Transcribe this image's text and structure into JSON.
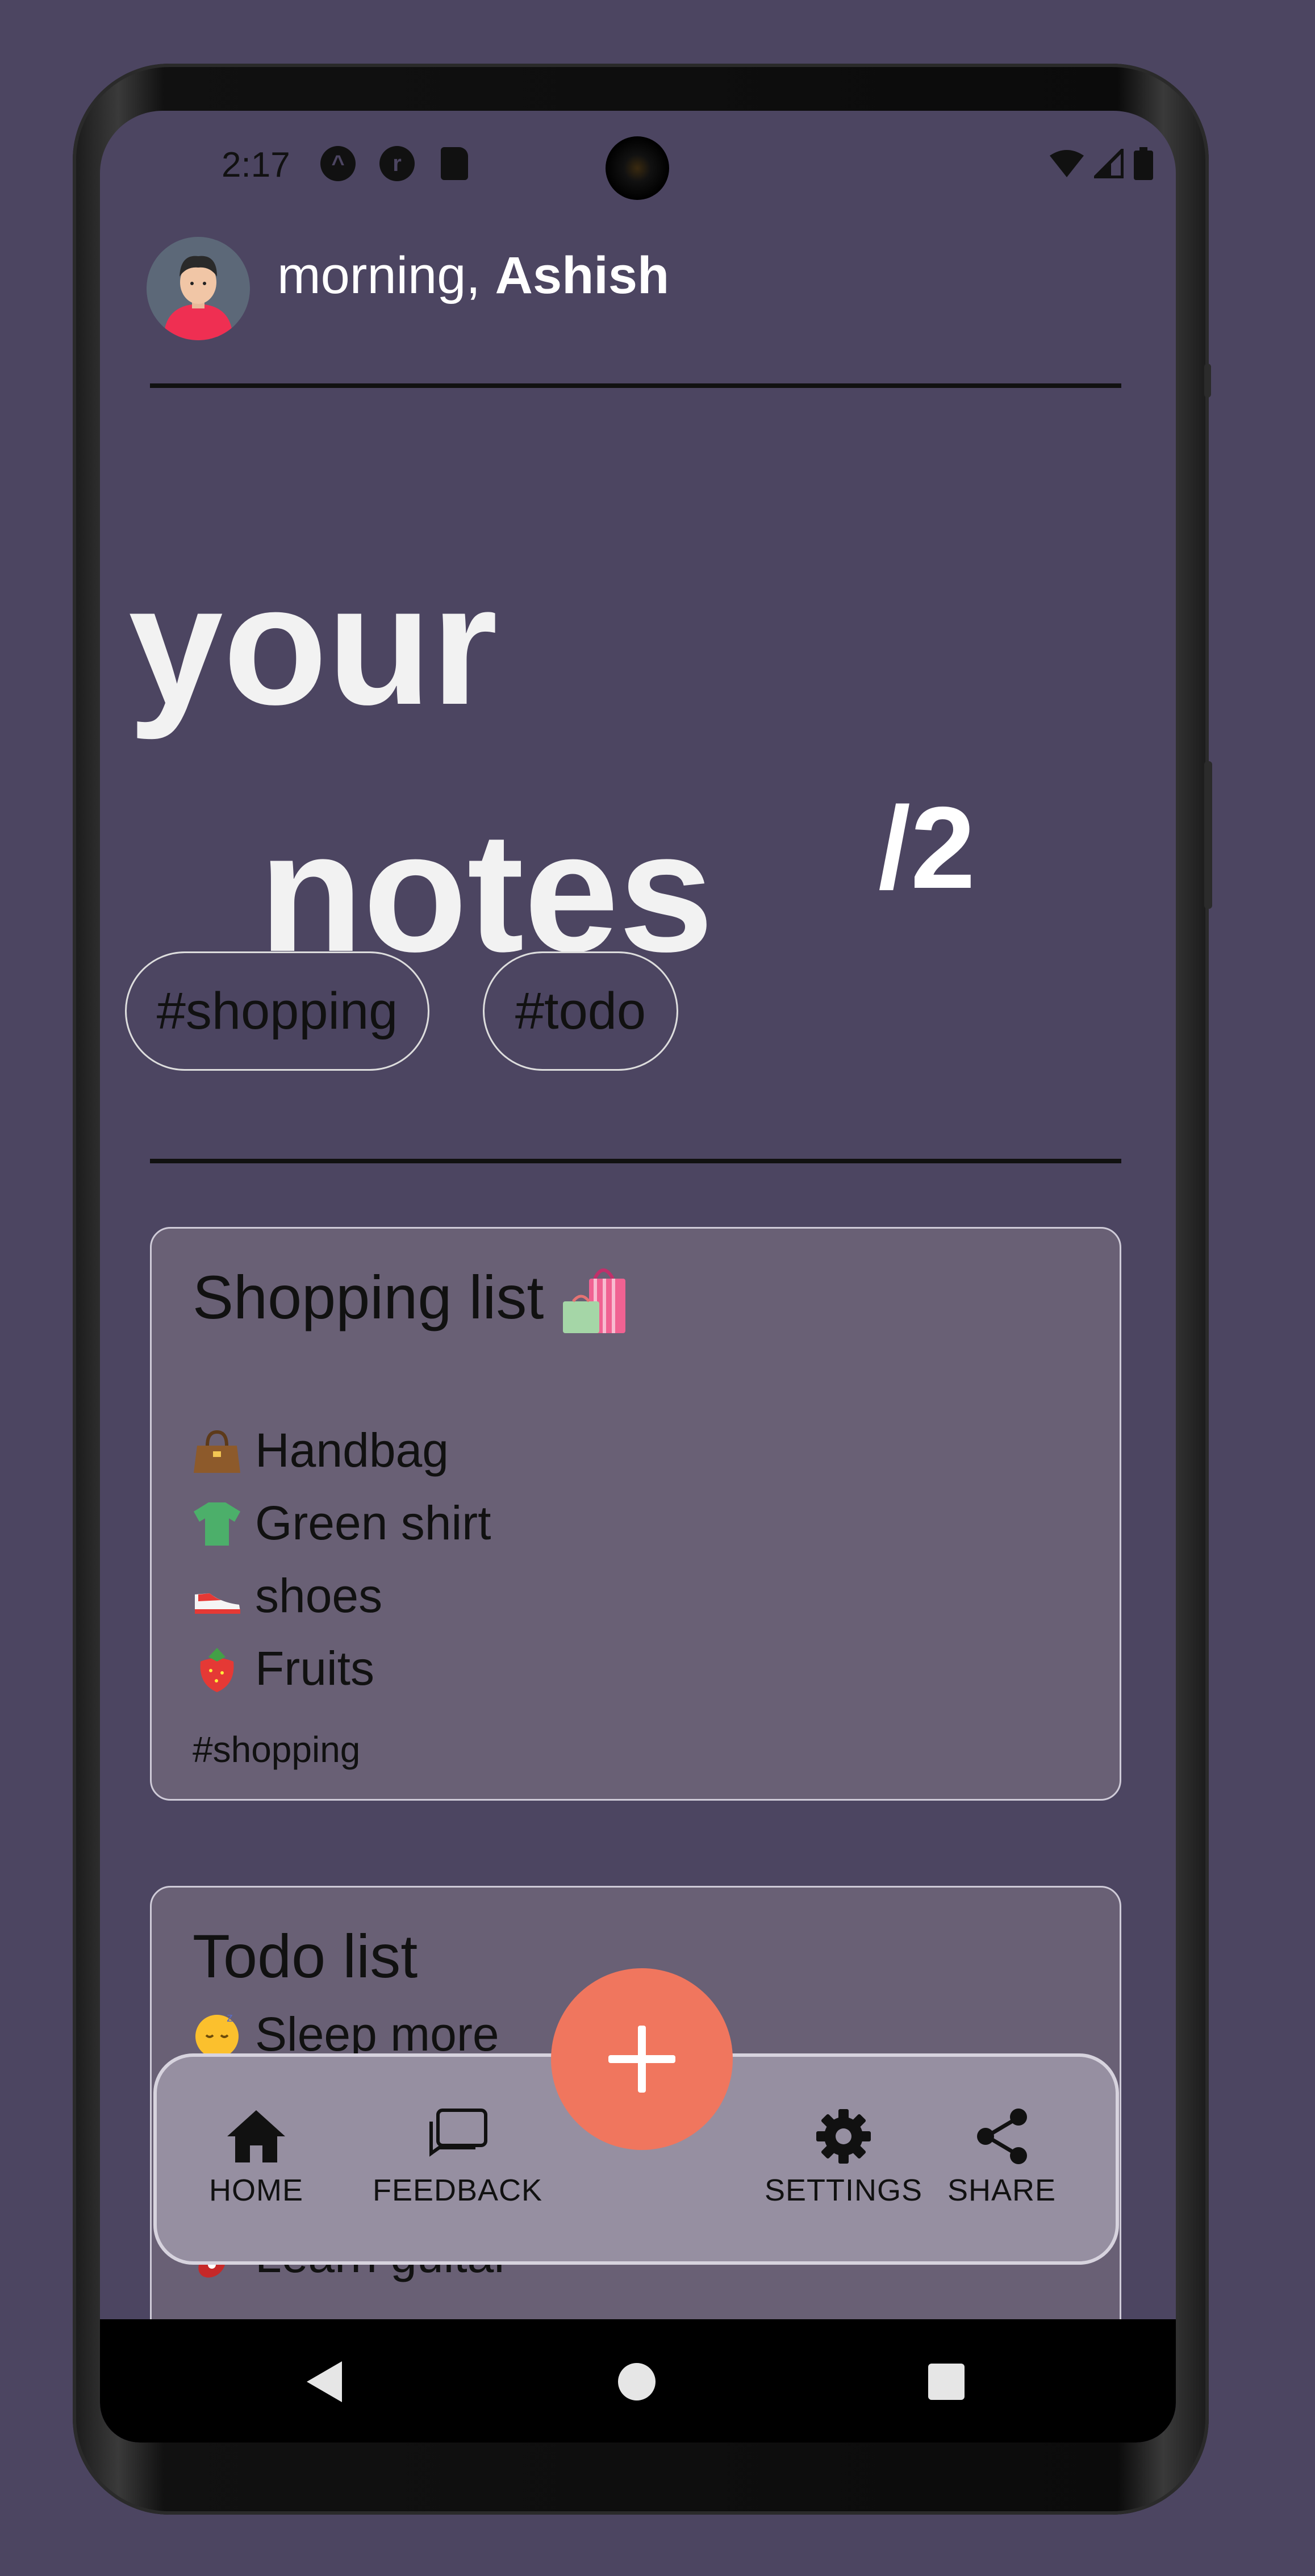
{
  "status_bar": {
    "time": "2:17"
  },
  "header": {
    "greeting_prefix": "morning,",
    "user_name": "Ashish"
  },
  "hero": {
    "line1": "your",
    "line2": "notes",
    "count": "/2"
  },
  "tags": [
    {
      "label": "#shopping"
    },
    {
      "label": "#todo"
    }
  ],
  "notes": [
    {
      "title": "Shopping list",
      "items": [
        {
          "icon": "handbag-emoji",
          "text": "Handbag"
        },
        {
          "icon": "shirt-emoji",
          "text": "Green shirt"
        },
        {
          "icon": "shoe-emoji",
          "text": "shoes"
        },
        {
          "icon": "strawberry-emoji",
          "text": "Fruits"
        }
      ],
      "tag": "#shopping"
    },
    {
      "title": "Todo list",
      "items": [
        {
          "icon": "sleeping-face-emoji",
          "text": "Sleep more"
        },
        {
          "icon": "guitar-emoji",
          "text": "Learn guitar"
        }
      ]
    }
  ],
  "bottom_nav": {
    "home": "HOME",
    "feedback": "FEEDBACK",
    "settings": "SETTINGS",
    "share": "SHARE"
  },
  "colors": {
    "background": "#4c4561",
    "card": "#696075",
    "fab": "#f0765e",
    "nav_bar": "#968fa1"
  }
}
